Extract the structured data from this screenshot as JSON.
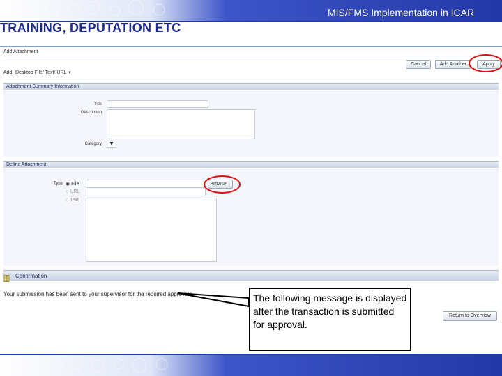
{
  "slide": {
    "header": "MIS/FMS Implementation in ICAR",
    "title": "TRAINING, DEPUTATION ETC"
  },
  "app": {
    "page_title": "Add Attachment",
    "buttons": {
      "cancel": "Cancel",
      "add_another": "Add Another",
      "apply": "Apply",
      "browse": "Browse...",
      "return_overview": "Return to Overview"
    },
    "add": {
      "label": "Add",
      "selected": "Desktop File/ Text/ URL"
    },
    "summary_section": {
      "header": "Attachment Summary Information",
      "title_label": "Title",
      "description_label": "Description",
      "category_label": "Category"
    },
    "define_section": {
      "header": "Define Attachment",
      "type_label": "Type",
      "options": [
        "File",
        "URL",
        "Text"
      ],
      "selected_option": "File"
    },
    "confirmation": {
      "header": "Confirmation",
      "message": "Your submission has been sent to your supervisor for the required approvals."
    }
  },
  "callout": {
    "text": "The following message is displayed after the transaction is submitted for approval."
  },
  "colors": {
    "accent_blue": "#2338a8",
    "title_blue": "#1b2a8c",
    "highlight_red": "#e01010"
  }
}
